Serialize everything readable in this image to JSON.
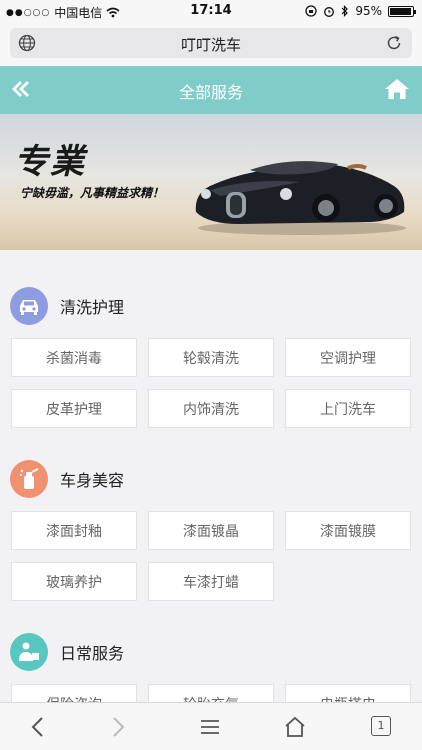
{
  "status": {
    "carrier": "中国电信",
    "time": "17:14",
    "battery": "95%",
    "battery_level": 0.95
  },
  "browser": {
    "page_title": "叮叮洗车",
    "tab_count": "1"
  },
  "header": {
    "title": "全部服务"
  },
  "banner": {
    "headline": "专業",
    "slogan": "宁缺毋滥，凡事精益求精！"
  },
  "sections": [
    {
      "title": "清洗护理",
      "icon": "car-icon",
      "icon_color": "#8e9de1",
      "items": [
        "杀菌消毒",
        "轮毂清洗",
        "空调护理",
        "皮革护理",
        "内饰清洗",
        "上门洗车"
      ]
    },
    {
      "title": "车身美容",
      "icon": "spray-can-icon",
      "icon_color": "#f0916f",
      "items": [
        "漆面封釉",
        "漆面镀晶",
        "漆面镀膜",
        "玻璃养护",
        "车漆打蜡"
      ]
    },
    {
      "title": "日常服务",
      "icon": "service-person-icon",
      "icon_color": "#58c7c0",
      "items": [
        "保险咨询",
        "轮胎充气",
        "电瓶搭电"
      ]
    }
  ],
  "colors": {
    "nav_bg": "#80ccc9",
    "page_bg": "#f2f2f4"
  }
}
